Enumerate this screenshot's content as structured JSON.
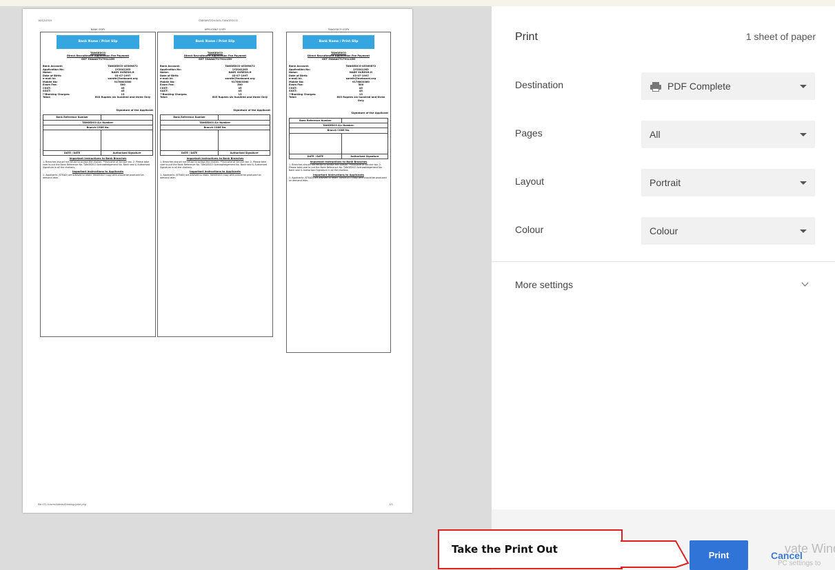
{
  "preview": {
    "header_left": "16/12/2019",
    "header_center": "CMKMNT/DV/AGL/TANGEDCO",
    "footer_left": "file:///C:/Users/Admin/Desktop/print.php",
    "footer_right": "1/1",
    "slips": [
      {
        "copy_label": "BANK COPY",
        "banner": "Bank Name / Print Slip",
        "title": "TANGEDCO",
        "subtitle": "Direct Recruitment Application Fee Payment",
        "gst": "GST 33AAACT1791L1ZH",
        "rows": [
          {
            "k": "Bank Account:",
            "v": "TANGEDCO-45369872"
          },
          {
            "k": "Application No:",
            "v": "1Y2041263"
          },
          {
            "k": "Name:",
            "v": "NADY SURESH.H"
          },
          {
            "k": "Date of Birth:",
            "v": "03-07-1997"
          },
          {
            "k": "e-mail Id:",
            "v": "sarath@tneboard.org"
          },
          {
            "k": "Mobile No:",
            "v": "9176803360"
          },
          {
            "k": "Exam Fee:",
            "v": "500"
          },
          {
            "k": "CGST:",
            "v": "45"
          },
          {
            "k": "SGST:",
            "v": "45"
          },
          {
            "k": "**Banking Charges:",
            "v": "13"
          },
          {
            "k": "Total:",
            "v": "603 Rupees six hundred and three Only"
          }
        ],
        "signature": "Signature of the Applicant",
        "ref_label": "Bank Reference Number",
        "tangedco_label": "TANGEDCO A/c Number:",
        "branch_label": "Branch CODE No.",
        "date_label": "DATE / DATE",
        "auth_label": "Authorised Signature",
        "inst_title": "Important Instructions to Bank Branches",
        "inst_text": "1. Branches should not refuse to accept the challan. **Inclusive of Service tax. 2. Please take care to put the Bank Reference No. TANGEDCO Acknowledgement No. Bank seal & Authorised Signature in all the challans.",
        "inst2_title": "Important Instructions to Applicants",
        "inst2_text": "1. Applicants (STEAD) are advised to retain TANGEDCO copy with should be produced on demand later."
      },
      {
        "copy_label": "APPLICANT COPY",
        "banner": "Bank Name / Print Slip",
        "title": "TANGEDCO",
        "subtitle": "Direct Recruitment Application Fee Payment",
        "gst": "GST 33AAACT1791L1ZH",
        "rows": [
          {
            "k": "Bank Account:",
            "v": "TANGEDCO-45369872"
          },
          {
            "k": "Application No:",
            "v": "1Y2041263"
          },
          {
            "k": "Name:",
            "v": "NADY SURESH.H"
          },
          {
            "k": "Date of Birth:",
            "v": "03-07-1997"
          },
          {
            "k": "e-mail Id:",
            "v": "sarath@tneboard.org"
          },
          {
            "k": "Mobile No:",
            "v": "9176803360"
          },
          {
            "k": "Exam Fee:",
            "v": "500"
          },
          {
            "k": "CGST:",
            "v": "45"
          },
          {
            "k": "SGST:",
            "v": "45"
          },
          {
            "k": "**Banking Charges:",
            "v": "13"
          },
          {
            "k": "Total:",
            "v": "603 Rupees six hundred and three Only"
          }
        ],
        "signature": "Signature of the Applicant",
        "ref_label": "Bank Reference Number",
        "tangedco_label": "TANGEDCO A/c Number:",
        "branch_label": "Branch CODE No.",
        "date_label": "DATE / DATE",
        "auth_label": "Authorised Signature",
        "inst_title": "Important Instructions to Bank Branches",
        "inst_text": "1. Branches should not refuse to accept the challan. **Inclusive of Service tax. 2. Please take care to put the Bank Reference No. TANGEDCO Acknowledgement No. Bank seal & Authorised Signature in all the challans.",
        "inst2_title": "Important Instructions to Applicants",
        "inst2_text": "1. Applicants (STEAD) are advised to retain TANGEDCO copy with should be produced on demand later."
      },
      {
        "copy_label": "TANGEDCO COPY",
        "banner": "Bank Name / Print Slip",
        "title": "TANGEDCO",
        "subtitle": "Direct Recruitment Application Fee Payment",
        "gst": "GST 33AAACT1791L1ZH",
        "rows": [
          {
            "k": "Bank Account:",
            "v": "TANGEDCO-45369872"
          },
          {
            "k": "Application No:",
            "v": "1Y2041263"
          },
          {
            "k": "Name:",
            "v": "NADY SURESH.H"
          },
          {
            "k": "Date of Birth:",
            "v": "03-07-1997"
          },
          {
            "k": "e-mail Id:",
            "v": "sarath@tneboard.org"
          },
          {
            "k": "Mobile No:",
            "v": "9176803360"
          },
          {
            "k": "Exam Fee:",
            "v": "500"
          },
          {
            "k": "CGST:",
            "v": "45"
          },
          {
            "k": "SGST:",
            "v": "45"
          },
          {
            "k": "**Banking Charges:",
            "v": "13"
          },
          {
            "k": "Total:",
            "v": "603 Rupees six hundred and three Only"
          }
        ],
        "signature": "Signature of the Applicant",
        "ref_label": "Bank Reference Number",
        "tangedco_label": "TANGEDCO A/c Number:",
        "branch_label": "Branch CODE No.",
        "date_label": "DATE / DATE",
        "auth_label": "Authorised Signature",
        "inst_title": "Important Instructions to Bank Branches",
        "inst_text": "1. Branches should not refuse to accept the challan. **Inclusive of Service tax. 2. Please take care to put the Bank Reference No. TANGEDCO Acknowledgement No. Bank seal & Authorised Signature in all the challans.",
        "inst2_title": "Important Instructions to Applicants",
        "inst2_text": "1. Applicants (STEAD) are advised to retain TANGEDCO copy with should be produced on demand later."
      }
    ]
  },
  "panel": {
    "title": "Print",
    "sheets": "1 sheet of paper",
    "settings": [
      {
        "label": "Destination",
        "value": "PDF Complete",
        "icon": "printer-icon"
      },
      {
        "label": "Pages",
        "value": "All"
      },
      {
        "label": "Layout",
        "value": "Portrait"
      },
      {
        "label": "Colour",
        "value": "Colour"
      }
    ],
    "more_settings": "More settings",
    "print_button": "Print",
    "cancel_button": "Cancel"
  },
  "watermark": {
    "line1": "vate Windo",
    "line2": "PC settings to"
  },
  "callout": {
    "text": "Take the Print Out",
    "border_color": "#e02020"
  },
  "colors": {
    "accent": "#2f74d6",
    "banner": "#35a6e0"
  }
}
